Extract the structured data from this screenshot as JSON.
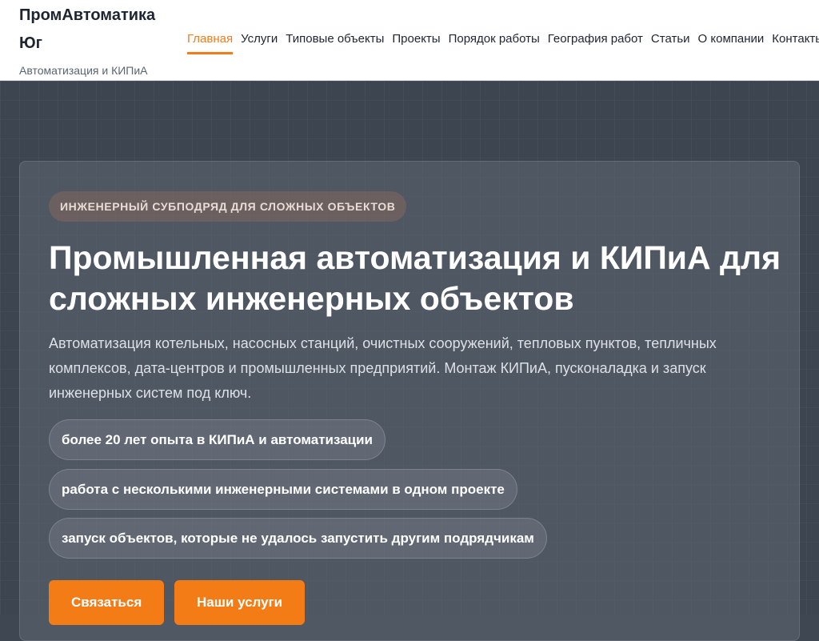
{
  "header": {
    "brand_name": "ПромАвтоматика Юг",
    "brand_tagline": "Автоматизация и КИПиА",
    "nav": [
      {
        "label": "Главная",
        "active": true
      },
      {
        "label": "Услуги"
      },
      {
        "label": "Типовые объекты"
      },
      {
        "label": "Проекты"
      },
      {
        "label": "Порядок работы"
      },
      {
        "label": "География работ"
      },
      {
        "label": "Статьи"
      },
      {
        "label": "О компании"
      },
      {
        "label": "Контакты"
      }
    ]
  },
  "hero": {
    "eyebrow": "Инженерный субподряд для сложных объектов",
    "title": "Промышленная автоматизация и КИПиА для сложных инженерных объектов",
    "description": "Автоматизация котельных, насосных станций, очистных сооружений, тепловых пунктов, тепличных комплексов, дата-центров и промышленных предприятий. Монтаж КИПиА, пусконаладка и запуск инженерных систем под ключ.",
    "highlights": [
      "более 20 лет опыта в КИПиА и автоматизации",
      "работа с несколькими инженерными системами в одном проекте",
      "запуск объектов, которые не удалось запустить другим подрядчикам"
    ],
    "buttons": {
      "contact": "Связаться",
      "services": "Наши услуги"
    }
  },
  "colors": {
    "accent": "#f47c16",
    "hero_background": "#3d4551",
    "header_background": "#ffffff"
  }
}
